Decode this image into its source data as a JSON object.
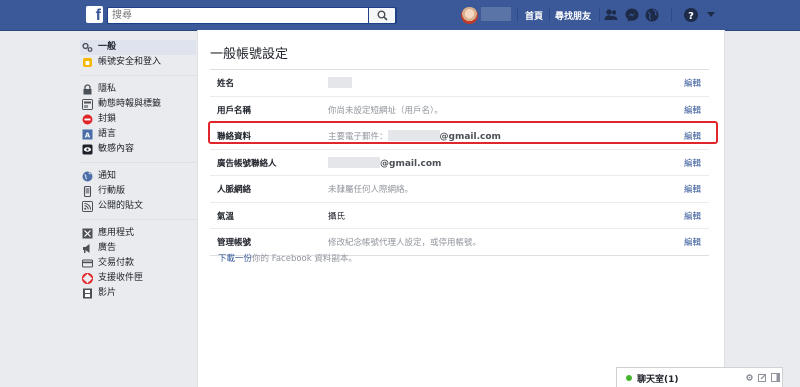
{
  "colors": {
    "brand": "#3b5998",
    "link": "#365899",
    "highlight_border": "#e0262b",
    "online_dot": "#42b72a"
  },
  "topbar": {
    "logo_icon": "facebook-f-icon",
    "search_placeholder": "搜尋",
    "search_icon": "search-icon",
    "nav": {
      "home_label": "首頁",
      "find_friends_label": "尋找朋友"
    },
    "icons": [
      "friend-requests-icon",
      "messenger-icon",
      "globe-notifications-icon",
      "help-icon",
      "caret-down-icon"
    ]
  },
  "sidebar": {
    "groups": [
      [
        {
          "label": "一般",
          "icon": "gear-icon",
          "active": true
        },
        {
          "label": "帳號安全和登入",
          "icon": "shield-icon",
          "active": false
        }
      ],
      [
        {
          "label": "隱私",
          "icon": "lock-icon",
          "active": false
        },
        {
          "label": "動態時報與標籤",
          "icon": "timeline-icon",
          "active": false
        },
        {
          "label": "封鎖",
          "icon": "block-icon",
          "active": false
        },
        {
          "label": "語言",
          "icon": "language-icon",
          "active": false
        },
        {
          "label": "敏感內容",
          "icon": "eye-icon",
          "active": false
        }
      ],
      [
        {
          "label": "通知",
          "icon": "globe-icon",
          "active": false
        },
        {
          "label": "行動版",
          "icon": "mobile-icon",
          "active": false
        },
        {
          "label": "公開的貼文",
          "icon": "rss-icon",
          "active": false
        }
      ],
      [
        {
          "label": "應用程式",
          "icon": "apps-icon",
          "active": false
        },
        {
          "label": "廣告",
          "icon": "ads-icon",
          "active": false
        },
        {
          "label": "交易付款",
          "icon": "payments-icon",
          "active": false
        },
        {
          "label": "支援收件匣",
          "icon": "lifebuoy-icon",
          "active": false
        },
        {
          "label": "影片",
          "icon": "film-icon",
          "active": false
        }
      ]
    ]
  },
  "main": {
    "title": "一般帳號設定",
    "edit_label": "編輯",
    "rows": [
      {
        "label": "姓名",
        "value": ""
      },
      {
        "label": "用戶名稱",
        "value": "你尚未設定短網址（用戶名）。"
      },
      {
        "label": "聯絡資料",
        "value_prefix": "主要電子郵件：",
        "email_suffix": "@gmail.com"
      },
      {
        "label": "廣告帳號聯絡人",
        "email_suffix": "@gmail.com"
      },
      {
        "label": "人脈網絡",
        "value": "未隸屬任何人際網絡。"
      },
      {
        "label": "氣溫",
        "value": "攝氏"
      },
      {
        "label": "管理帳號",
        "value": "修改紀念帳號代理人設定，或停用帳號。"
      }
    ],
    "download": {
      "link_text": "下載一份",
      "rest_text": "你的 Facebook 資料副本。"
    }
  },
  "chat": {
    "label": "聊天室(1)",
    "icons": [
      "gear-icon",
      "compose-icon",
      "sidebar-toggle-icon"
    ]
  }
}
